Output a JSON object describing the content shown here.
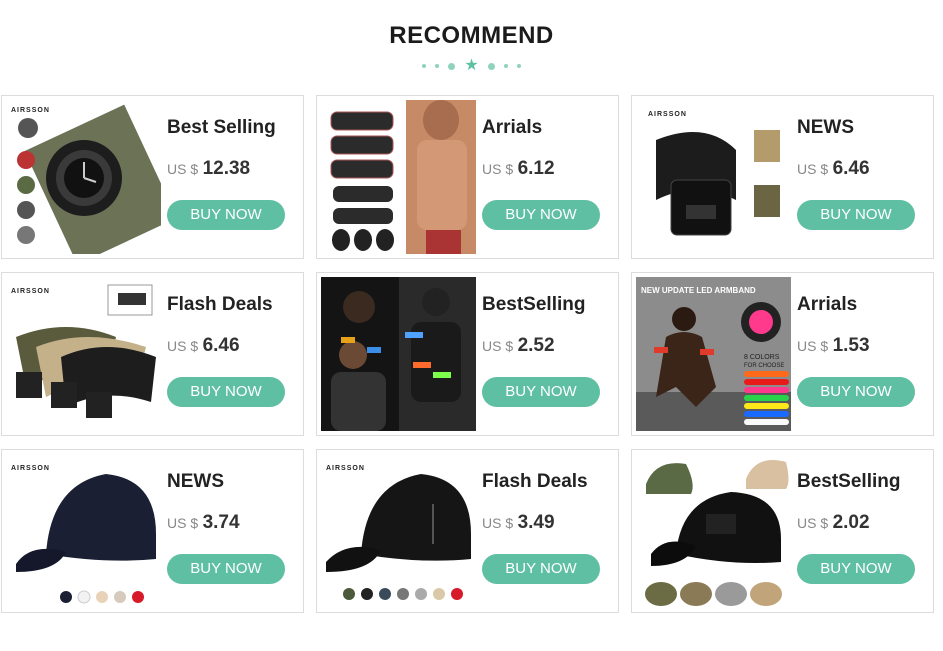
{
  "section_title": "RECOMMEND",
  "accent_color": "#5fbfa2",
  "cards": [
    {
      "label": "Best Selling",
      "currency": "US $",
      "price": "12.38",
      "button": "BUY NOW",
      "image": "tactical-watch-image",
      "brand": "AIRSSON"
    },
    {
      "label": "Arrials",
      "currency": "US $",
      "price": "6.12",
      "button": "BUY NOW",
      "image": "ab-muscle-stimulator-image",
      "brand": ""
    },
    {
      "label": "NEWS",
      "currency": "US $",
      "price": "6.46",
      "button": "BUY NOW",
      "image": "tactical-belt-image",
      "brand": "AIRSSON"
    },
    {
      "label": "Flash Deals",
      "currency": "US $",
      "price": "6.46",
      "button": "BUY NOW",
      "image": "belts-image",
      "brand": "AIRSSON"
    },
    {
      "label": "BestSelling",
      "currency": "US $",
      "price": "2.52",
      "button": "BUY NOW",
      "image": "led-armband-people-image",
      "brand": ""
    },
    {
      "label": "Arrials",
      "currency": "US $",
      "price": "1.53",
      "button": "BUY NOW",
      "image": "led-armband-runner-image",
      "brand": "",
      "banner": "NEW UPDATE LED ARMBAND",
      "badge_line1": "8 COLORS",
      "badge_line2": "FOR CHOOSE"
    },
    {
      "label": "NEWS",
      "currency": "US $",
      "price": "3.74",
      "button": "BUY NOW",
      "image": "black-baseball-cap-image",
      "brand": "AIRSSON"
    },
    {
      "label": "Flash Deals",
      "currency": "US $",
      "price": "3.49",
      "button": "BUY NOW",
      "image": "mesh-cap-image",
      "brand": "AIRSSON"
    },
    {
      "label": "BestSelling",
      "currency": "US $",
      "price": "2.02",
      "button": "BUY NOW",
      "image": "tactical-cap-image",
      "brand": ""
    }
  ]
}
